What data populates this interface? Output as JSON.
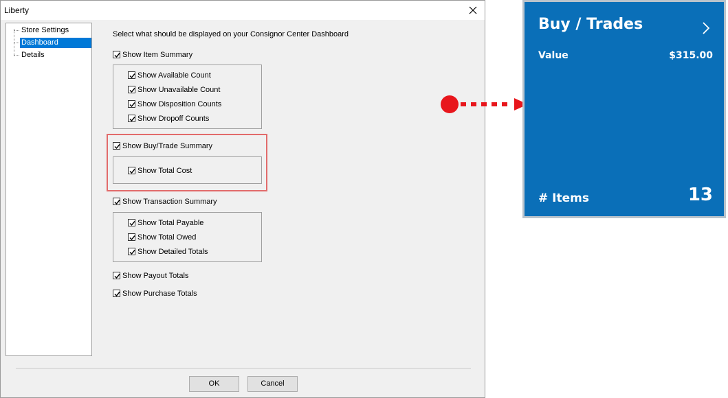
{
  "window": {
    "title": "Liberty",
    "close_icon": "close-icon"
  },
  "tree": {
    "items": [
      {
        "label": "Store Settings"
      },
      {
        "label": "Dashboard"
      },
      {
        "label": "Details"
      }
    ],
    "selected": "Dashboard"
  },
  "panel": {
    "heading": "Select what should be displayed on your Consignor Center Dashboard",
    "item_summary": {
      "label": "Show Item Summary",
      "checked": true,
      "children": [
        {
          "label": "Show Available Count",
          "checked": true
        },
        {
          "label": "Show Unavailable Count",
          "checked": true
        },
        {
          "label": "Show Disposition Counts",
          "checked": true
        },
        {
          "label": "Show Dropoff Counts",
          "checked": true
        }
      ]
    },
    "buy_trade_summary": {
      "label": "Show Buy/Trade Summary",
      "checked": true,
      "children": [
        {
          "label": "Show Total Cost",
          "checked": true
        }
      ]
    },
    "transaction_summary": {
      "label": "Show Transaction Summary",
      "checked": true,
      "children": [
        {
          "label": "Show Total Payable",
          "checked": true
        },
        {
          "label": "Show Total Owed",
          "checked": true
        },
        {
          "label": "Show Detailed Totals",
          "checked": true
        }
      ]
    },
    "payout_totals": {
      "label": "Show Payout Totals",
      "checked": true
    },
    "purchase_totals": {
      "label": "Show Purchase Totals",
      "checked": true
    }
  },
  "buttons": {
    "ok": "OK",
    "cancel": "Cancel"
  },
  "tile": {
    "title": "Buy / Trades",
    "value_label": "Value",
    "value": "$315.00",
    "items_label": "# Items",
    "items_count": "13",
    "background": "#0a6fb8",
    "chevron_icon": "chevron-right-icon"
  },
  "colors": {
    "highlight_border": "#e26b6b",
    "arrow": "#e8161c",
    "selection": "#0078d7"
  }
}
